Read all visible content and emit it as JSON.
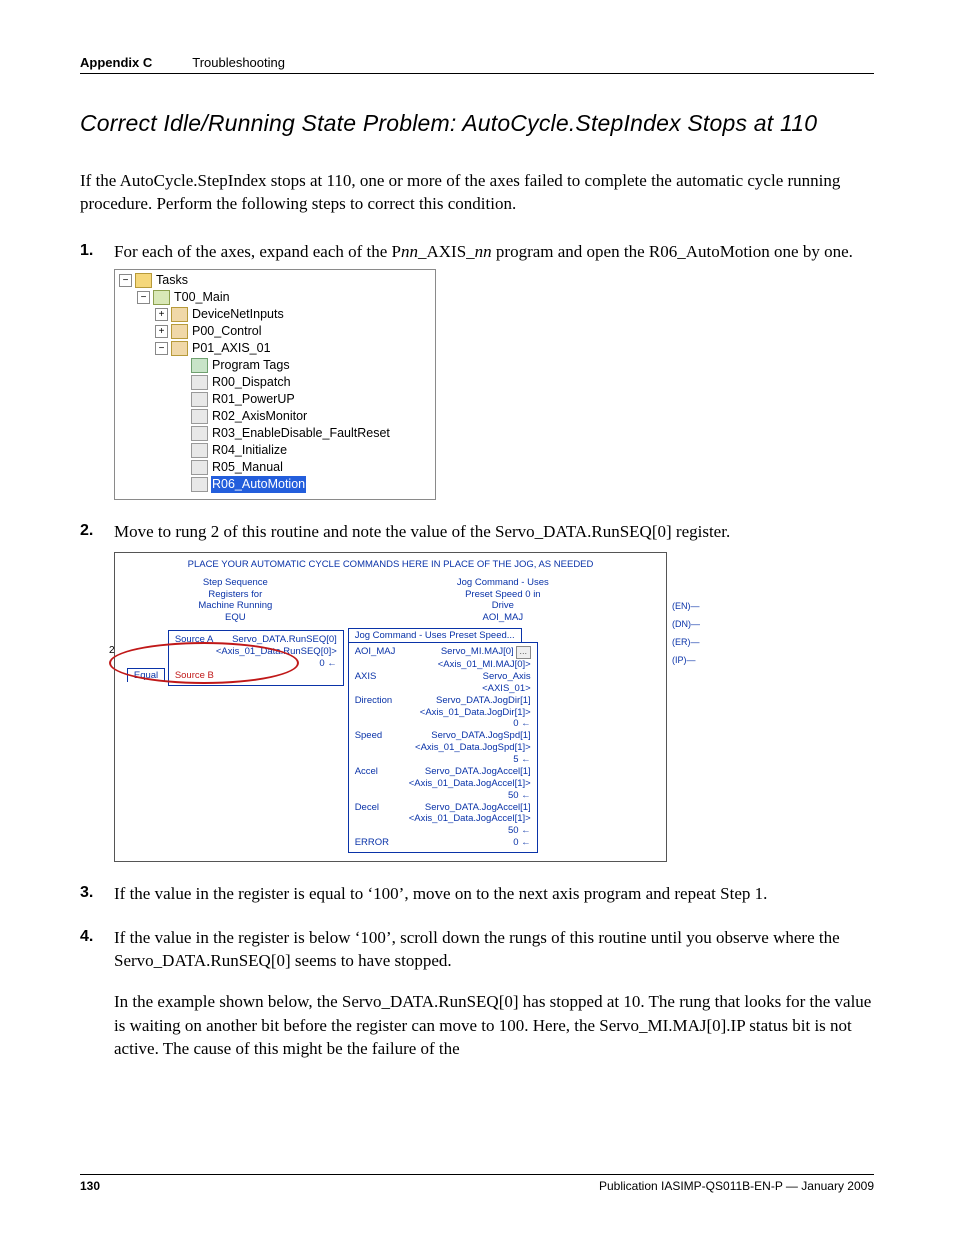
{
  "header": {
    "appendix": "Appendix C",
    "section": "Troubleshooting"
  },
  "title": "Correct Idle/Running State Problem: AutoCycle.StepIndex Stops at 110",
  "intro": "If the AutoCycle.StepIndex stops at 110, one or more of the axes failed to complete the automatic cycle running procedure. Perform the following steps to correct this condition.",
  "steps": {
    "s1a": "For each of the axes, expand each of the P",
    "s1_var1": "nn",
    "s1b": "_AXIS_",
    "s1_var2": "nn",
    "s1c": " program and open the R06_AutoMotion one by one.",
    "s2": "Move to rung 2 of this routine and note the value of the Servo_DATA.RunSEQ[0] register.",
    "s3": "If the value in the register is equal to ‘100’, move on to the next axis program and repeat Step 1.",
    "s4": "If the value in the register is below ‘100’, scroll down the rungs of this routine until you observe where the Servo_DATA.RunSEQ[0] seems to have stopped.",
    "s4_p2": "In the example shown below, the Servo_DATA.RunSEQ[0] has stopped at 10. The rung that looks for the value is waiting on another bit before the register can move to 100. Here, the Servo_MI.MAJ[0].IP status bit is not active. The cause of this might be the failure of the"
  },
  "tree": {
    "root": "Tasks",
    "task": "T00_Main",
    "n1": "DeviceNetInputs",
    "n2": "P00_Control",
    "n3": "P01_AXIS_01",
    "r_tags": "Program Tags",
    "r0": "R00_Dispatch",
    "r1": "R01_PowerUP",
    "r2": "R02_AxisMonitor",
    "r3": "R03_EnableDisable_FaultReset",
    "r4": "R04_Initialize",
    "r5": "R05_Manual",
    "r6": "R06_AutoMotion"
  },
  "ladder": {
    "banner": "PLACE YOUR AUTOMATIC CYCLE COMMANDS HERE IN PLACE OF THE JOG, AS NEEDED",
    "left_hdr1": "Step Sequence",
    "left_hdr2": "Registers for",
    "left_hdr3": "Machine Running",
    "equ_cap": "EQU",
    "equ_l1": "Equal",
    "equ_srcA_l": "Source A",
    "equ_srcA_v": "Servo_DATA.RunSEQ[0]",
    "equ_srcA_sub": "<Axis_01_Data.RunSEQ[0]>",
    "equ_srcA_val": "0 ←",
    "equ_srcB_l": "Source B",
    "right_hdr1": "Jog Command - Uses",
    "right_hdr2": "Preset Speed 0 in",
    "right_hdr3": "Drive",
    "right_aoi": "AOI_MAJ",
    "aoi_title": "Jog Command - Uses Preset Speed...",
    "r_aoimaj_l": "AOI_MAJ",
    "r_aoimaj_v": "Servo_MI.MAJ[0]",
    "r_aoimaj_sub": "<Axis_01_MI.MAJ[0]>",
    "r_axis_l": "AXIS",
    "r_axis_v": "Servo_Axis",
    "r_axis_sub": "<AXIS_01>",
    "r_dir_l": "Direction",
    "r_dir_v": "Servo_DATA.JogDir[1]",
    "r_dir_sub": "<Axis_01_Data.JogDir[1]>",
    "r_dir_val": "0 ←",
    "r_spd_l": "Speed",
    "r_spd_v": "Servo_DATA.JogSpd[1]",
    "r_spd_sub": "<Axis_01_Data.JogSpd[1]>",
    "r_spd_val": "5 ←",
    "r_acc_l": "Accel",
    "r_acc_v": "Servo_DATA.JogAccel[1]",
    "r_acc_sub": "<Axis_01_Data.JogAccel[1]>",
    "r_acc_val": "50 ←",
    "r_dec_l": "Decel",
    "r_dec_v": "Servo_DATA.JogAccel[1]",
    "r_dec_sub": "<Axis_01_Data.JogAccel[1]>",
    "r_dec_val": "50 ←",
    "r_err_l": "ERROR",
    "r_err_v": "0 ←",
    "pin1": "(EN)—",
    "pin2": "(DN)—",
    "pin3": "(ER)—",
    "pin4": "(IP)—",
    "rung_no": "2"
  },
  "footer": {
    "page": "130",
    "pub": "Publication IASIMP-QS011B-EN-P — January 2009"
  }
}
